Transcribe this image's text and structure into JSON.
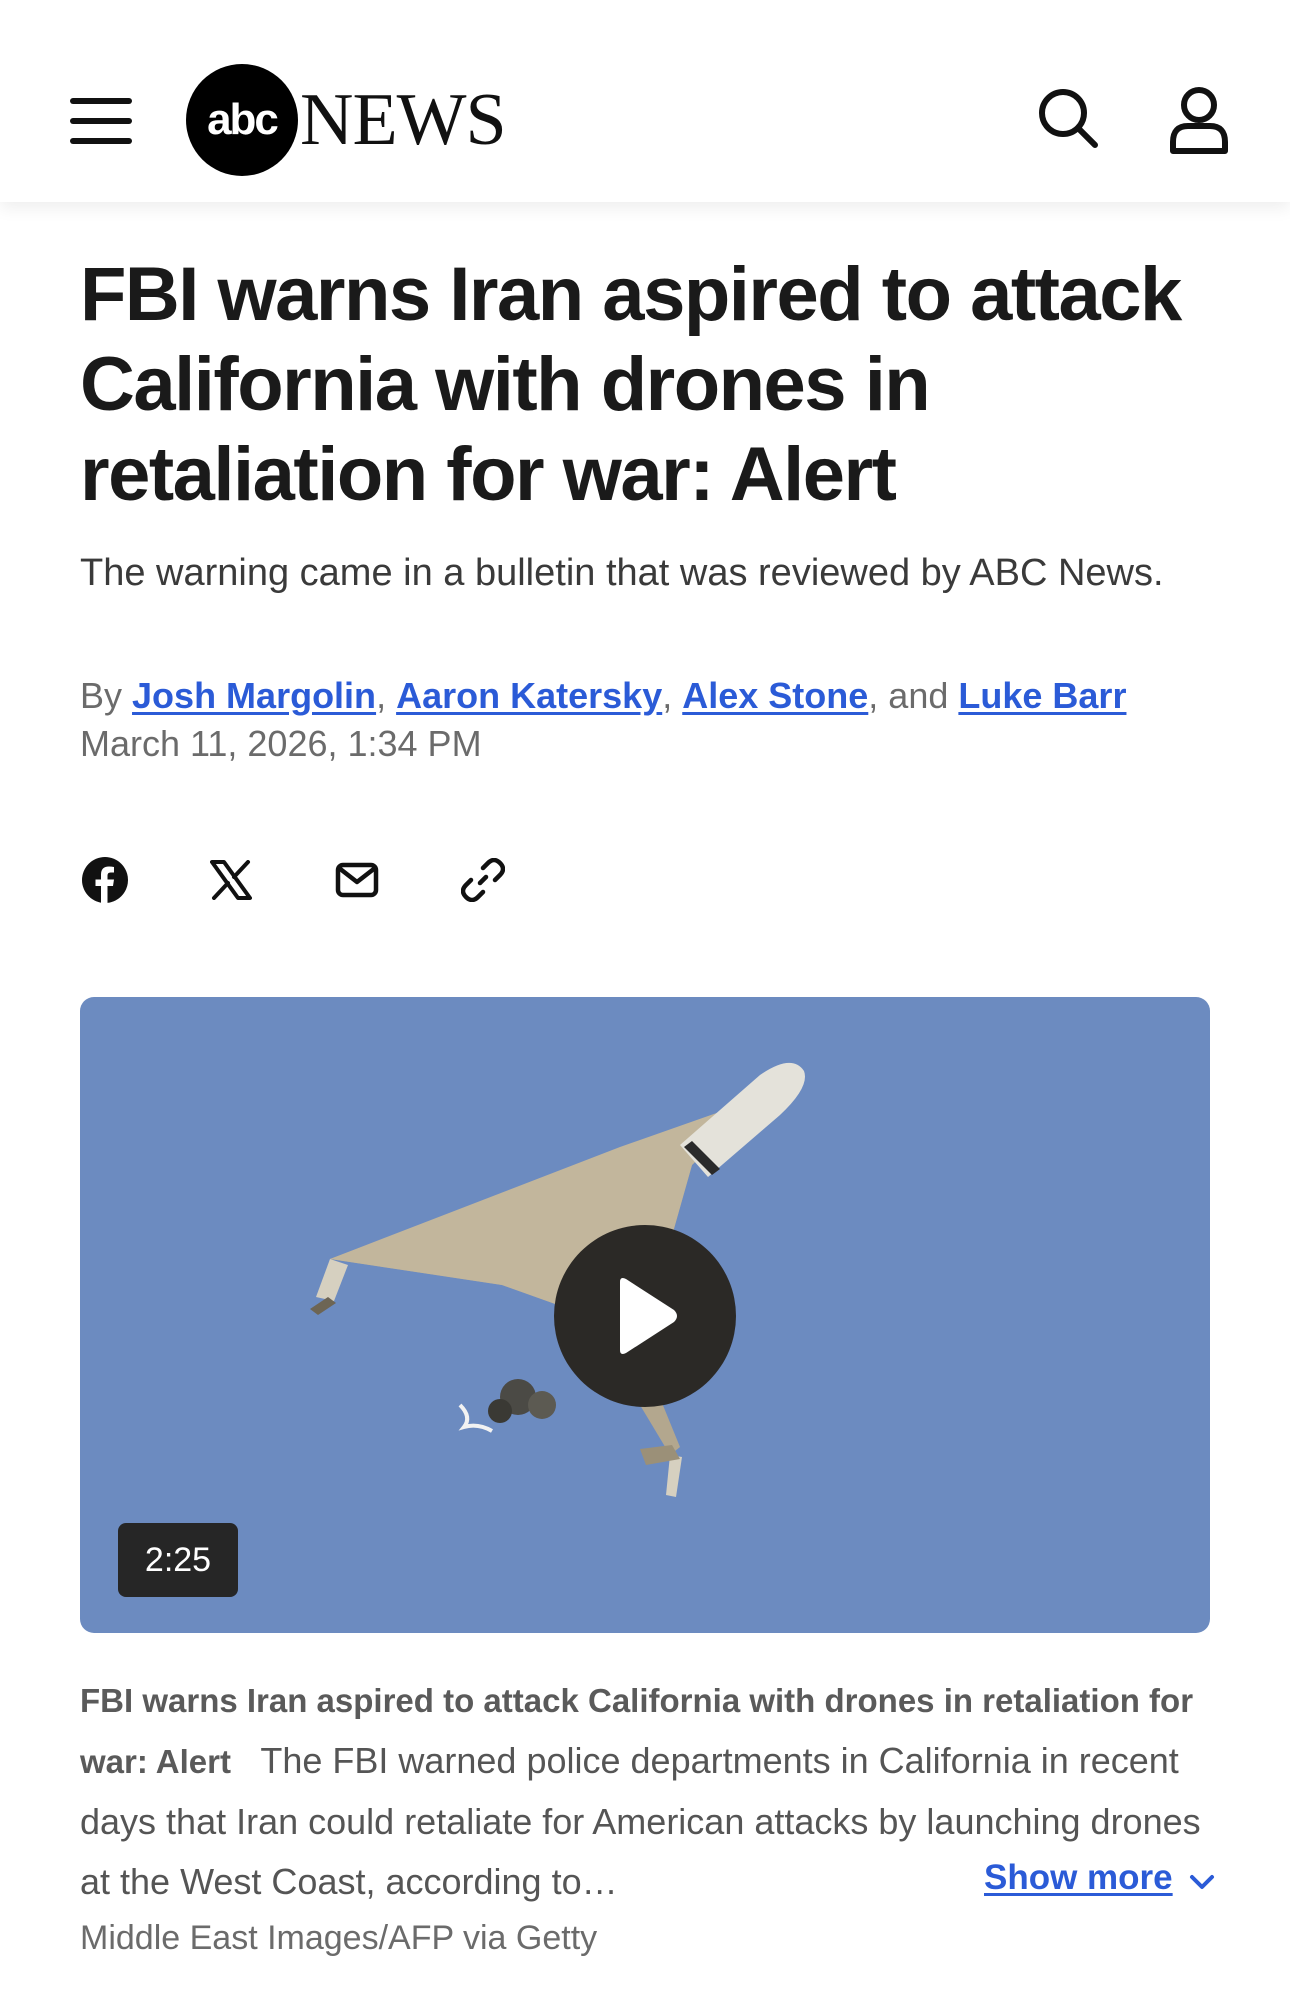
{
  "header": {
    "logo_abc": "abc",
    "logo_news": "NEWS",
    "menu_icon": "hamburger-menu-icon",
    "search_icon": "search-icon",
    "account_icon": "user-icon"
  },
  "article": {
    "headline": "FBI warns Iran aspired to attack California with drones in retaliation for war: Alert",
    "subhead": "The warning came in a bulletin that was reviewed by ABC News.",
    "byline": {
      "prefix": "By",
      "authors": [
        "Josh Margolin",
        "Aaron Katersky",
        "Alex Stone",
        "Luke Barr"
      ],
      "sep1": ",",
      "sep2": ",",
      "sep3": ", and"
    },
    "date": "March 11, 2026, 1:34 PM"
  },
  "share": {
    "icons": [
      "facebook-icon",
      "x-icon",
      "email-icon",
      "link-icon"
    ]
  },
  "video": {
    "duration": "2:25",
    "play_icon": "play-icon"
  },
  "caption": {
    "title": "FBI warns Iran aspired to attack California with drones in retaliation for war: Alert",
    "text": "The FBI warned police departments in California in recent days that Iran could retaliate for American attacks by launching drones at the West Coast, according to…",
    "show_more": "Show more",
    "credit": "Middle East Images/AFP via Getty"
  },
  "colors": {
    "link": "#2b5bd7",
    "video_bg": "#6c8bc0",
    "headline": "#1a1a1a"
  }
}
